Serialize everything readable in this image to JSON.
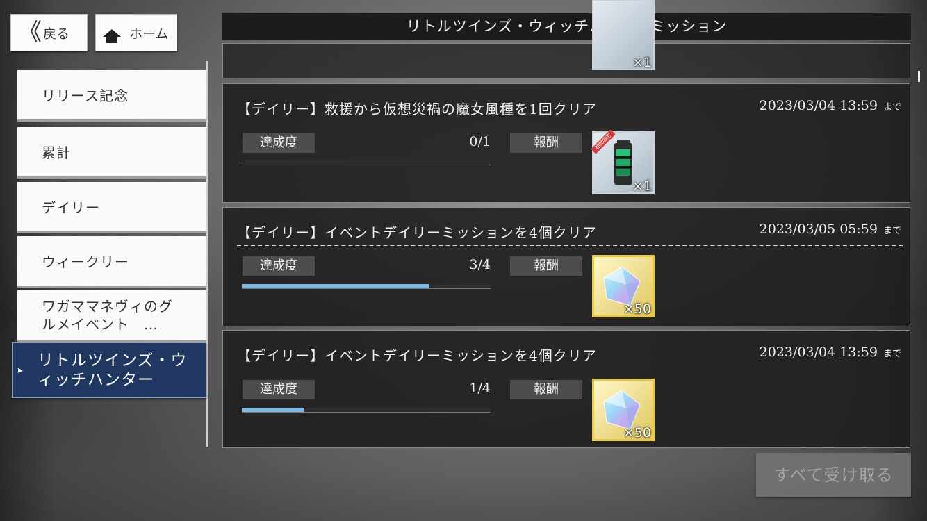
{
  "nav": {
    "back_label": "戻る",
    "home_label": "ホーム"
  },
  "title": "リトルツインズ・ウィッチハンターミッション",
  "sidebar": {
    "tabs": [
      {
        "label": "リリース記念"
      },
      {
        "label": "累計"
      },
      {
        "label": "デイリー"
      },
      {
        "label": "ウィークリー"
      },
      {
        "label_line1": "ワガママネヴィのグ",
        "label_line2": "ルメイベント　…"
      },
      {
        "label_line1": "リトルツインズ・ウ",
        "label_line2": "ィッチハンター",
        "active": true
      }
    ]
  },
  "labels": {
    "achievement": "達成度",
    "reward": "報酬",
    "deadline_suffix": "まで"
  },
  "missions": [
    {
      "title": "【デイリー】救援から仮想災禍の魔女風種を1回クリア",
      "deadline": "2023/03/04 13:59",
      "progress_text": "0/1",
      "progress": 0.0,
      "reward_icon": "battery-icon",
      "reward_qty": "×1",
      "reward_badge": "期間限定"
    },
    {
      "title": "【デイリー】イベントデイリーミッションを4個クリア",
      "deadline": "2023/03/05 05:59",
      "progress_text": "3/4",
      "progress": 0.75,
      "reward_icon": "crystal-icon",
      "reward_qty": "×50"
    },
    {
      "title": "【デイリー】イベントデイリーミッションを4個クリア",
      "deadline": "2023/03/04 13:59",
      "progress_text": "1/4",
      "progress": 0.25,
      "reward_icon": "crystal-icon",
      "reward_qty": "×50"
    }
  ],
  "partial_top": {
    "reward_qty": "×1"
  },
  "claim_all_label": "すべて受け取る",
  "colors": {
    "progress_fill": "#7db9e6",
    "active_tab": "#1f3761",
    "title_bar": "#1c1c1c"
  }
}
